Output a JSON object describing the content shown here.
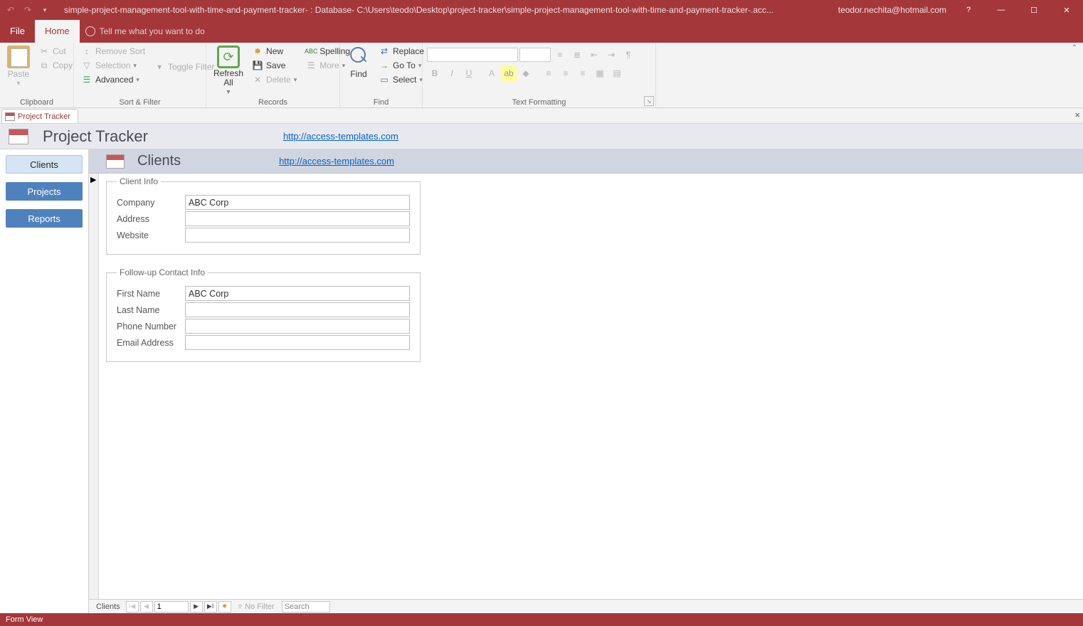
{
  "titlebar": {
    "title": "simple-project-management-tool-with-time-and-payment-tracker- : Database- C:\\Users\\teodo\\Desktop\\project-tracker\\simple-project-management-tool-with-time-and-payment-tracker-.acc...",
    "account": "teodor.nechita@hotmail.com"
  },
  "tabs": {
    "file": "File",
    "home": "Home",
    "tellme": "Tell me what you want to do"
  },
  "ribbon": {
    "clipboard": {
      "label": "Clipboard",
      "paste": "Paste",
      "cut": "Cut",
      "copy": "Copy"
    },
    "sortfilter": {
      "label": "Sort & Filter",
      "remove": "Remove Sort",
      "selection": "Selection",
      "toggle": "Toggle Filter",
      "advanced": "Advanced"
    },
    "records": {
      "label": "Records",
      "refresh": "Refresh All",
      "new": "New",
      "save": "Save",
      "delete": "Delete",
      "spelling": "Spelling",
      "more": "More"
    },
    "find": {
      "label": "Find",
      "find": "Find",
      "replace": "Replace",
      "goto": "Go To",
      "select": "Select"
    },
    "textfmt": {
      "label": "Text Formatting"
    }
  },
  "doctab": {
    "label": "Project Tracker"
  },
  "mainheader": {
    "title": "Project Tracker",
    "link": "http://access-templates.com"
  },
  "sidebar": {
    "clients": "Clients",
    "projects": "Projects",
    "reports": "Reports"
  },
  "subheader": {
    "title": "Clients",
    "link": "http://access-templates.com"
  },
  "fieldsets": {
    "client": {
      "legend": "Client Info",
      "company_label": "Company",
      "company_value": "ABC Corp",
      "address_label": "Address",
      "address_value": "",
      "website_label": "Website",
      "website_value": ""
    },
    "contact": {
      "legend": "Follow-up Contact Info",
      "firstname_label": "First Name",
      "firstname_value": "ABC Corp",
      "lastname_label": "Last Name",
      "lastname_value": "",
      "phone_label": "Phone Number",
      "phone_value": "",
      "email_label": "Email Address",
      "email_value": ""
    }
  },
  "recnav": {
    "label": "Clients",
    "record": "1",
    "filter": "No Filter",
    "search": "Search"
  },
  "statusbar": {
    "text": "Form View"
  }
}
